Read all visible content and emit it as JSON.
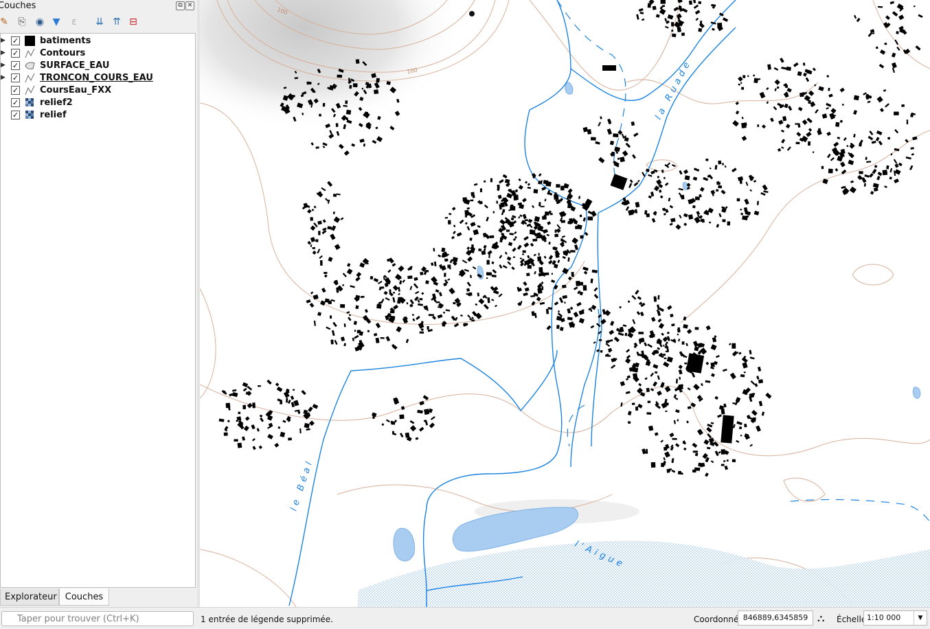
{
  "panel": {
    "title": "Couches",
    "toolbar_icons": [
      "style-brush-icon",
      "add-group-icon",
      "visibility-eye-icon",
      "filter-icon",
      "expression-filter-icon",
      "expand-all-icon",
      "collapse-all-icon",
      "remove-layer-icon"
    ],
    "layers": [
      {
        "name": "batiments",
        "checked": "✓",
        "symbol": "polygon-fill-black",
        "underlined": false,
        "expandable": true
      },
      {
        "name": "Contours",
        "checked": "✓",
        "symbol": "line-symbol",
        "underlined": false,
        "expandable": true
      },
      {
        "name": "SURFACE_EAU",
        "checked": "✓",
        "symbol": "polygon-outline",
        "underlined": false,
        "expandable": true
      },
      {
        "name": "TRONCON_COURS_EAU",
        "checked": "✓",
        "symbol": "line-symbol",
        "underlined": true,
        "expandable": true
      },
      {
        "name": "CoursEau_FXX",
        "checked": "✓",
        "symbol": "line-symbol",
        "underlined": false,
        "expandable": false
      },
      {
        "name": "relief2",
        "checked": "✓",
        "symbol": "raster-icon",
        "underlined": false,
        "expandable": false
      },
      {
        "name": "relief",
        "checked": "✓",
        "symbol": "raster-icon",
        "underlined": false,
        "expandable": false
      }
    ],
    "tabs": {
      "explorer": "Explorateur",
      "layers": "Couches"
    }
  },
  "statusbar": {
    "search_placeholder": "Taper pour trouver (Ctrl+K)",
    "message": "1 entrée de légende supprimée.",
    "coordinate_label": "Coordonnée",
    "coordinate_value": "846889,6345859",
    "scale_label": "Échelle",
    "scale_value": "1:10 000"
  },
  "map": {
    "labels": {
      "contour_100_a": "100",
      "contour_100_b": "100",
      "river_ruade": "la Ruade",
      "river_beal": "le Béal",
      "river_aigue": "l'Aigue"
    },
    "colors": {
      "water_line": "#1a82e0",
      "water_fill": "#a9cdf0",
      "contour": "#d8b09a",
      "building": "#000000"
    }
  }
}
